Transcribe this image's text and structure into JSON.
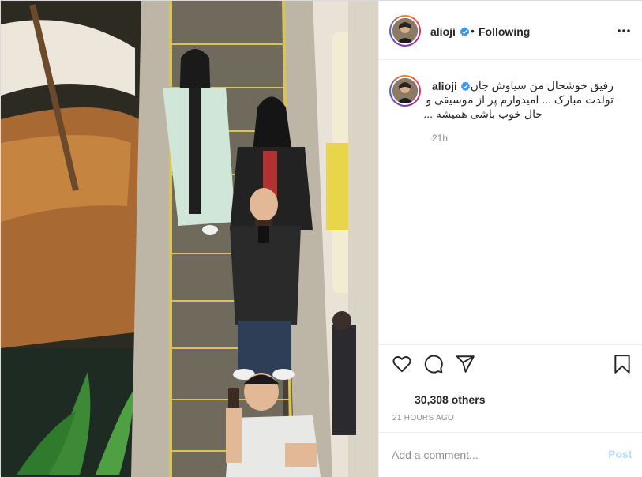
{
  "post": {
    "username": "alioji",
    "separator": "•",
    "follow_status": "Following",
    "caption": {
      "line1": "رفیق خوشحال من سیاوش جان",
      "line2": "تولدت مبارک ... امیدوارم پر از موسیقی و",
      "line3": "حال خوب باشی همیشه ..."
    },
    "time_short": "21h",
    "likes": "30,308 others",
    "time_long": "21 HOURS AGO",
    "comment_placeholder": "Add a comment...",
    "post_label": "Post"
  },
  "icons": {
    "verified": "verified-badge-icon",
    "more": "more-options-icon",
    "like": "heart-icon",
    "comment": "comment-icon",
    "share": "share-icon",
    "save": "bookmark-icon"
  },
  "colors": {
    "verified": "#3897f0",
    "post_disabled": "#b2dffc",
    "muted": "#8e8e8e",
    "escalator_rail": "#d8c35a"
  }
}
